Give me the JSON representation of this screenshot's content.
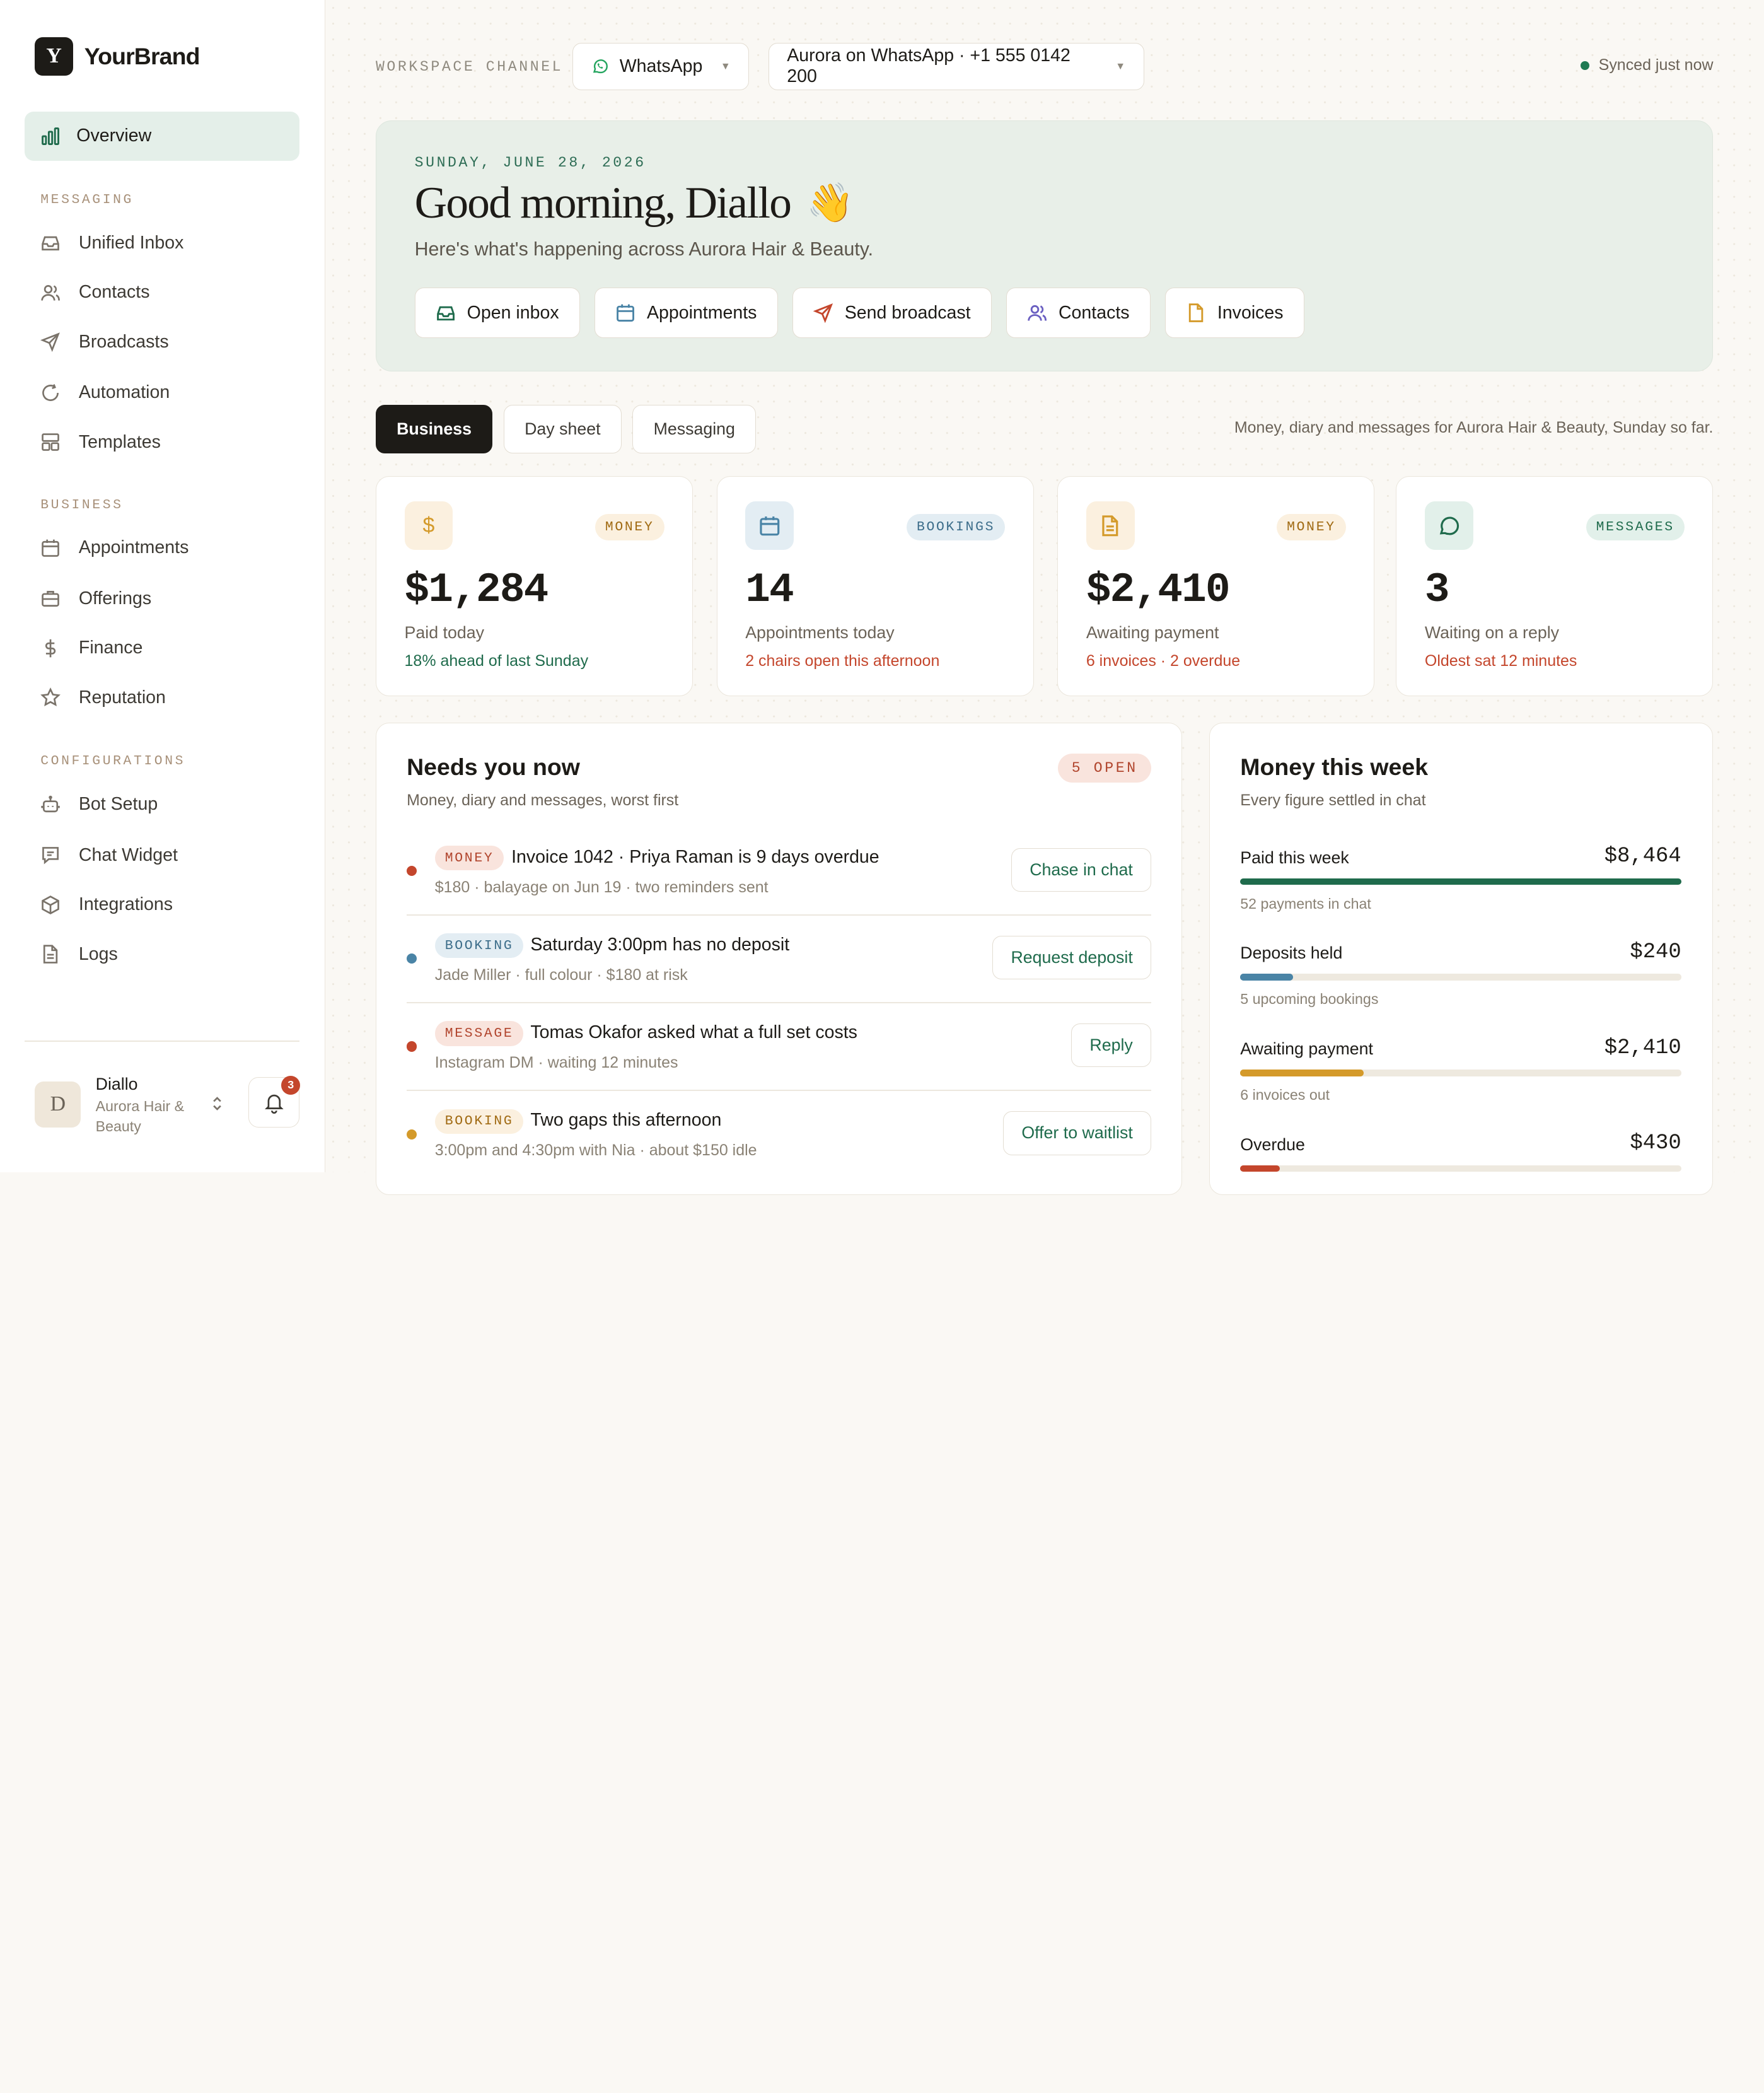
{
  "brand": {
    "logo_letter": "Y",
    "name": "YourBrand"
  },
  "nav": {
    "overview": "Overview",
    "sections": [
      {
        "title": "MESSAGING",
        "items": [
          "Unified Inbox",
          "Contacts",
          "Broadcasts",
          "Automation",
          "Templates"
        ]
      },
      {
        "title": "BUSINESS",
        "items": [
          "Appointments",
          "Offerings",
          "Finance",
          "Reputation"
        ]
      },
      {
        "title": "CONFIGURATIONS",
        "items": [
          "Bot Setup",
          "Chat Widget",
          "Integrations",
          "Logs"
        ]
      }
    ]
  },
  "user": {
    "initial": "D",
    "name": "Diallo",
    "business": "Aurora Hair & Beauty",
    "notifications": "3"
  },
  "topbar": {
    "workspace_label": "WORKSPACE CHANNEL",
    "channel": "WhatsApp",
    "account": "Aurora on WhatsApp · +1 555 0142 200",
    "sync_status": "Synced just now",
    "sync_color": "#1f7a52"
  },
  "hero": {
    "date": "SUNDAY, JUNE 28, 2026",
    "greeting": "Good morning, Diallo",
    "wave": "👋",
    "subtitle": "Here's what's happening across Aurora Hair & Beauty.",
    "quick_actions": [
      {
        "label": "Open inbox",
        "icon": "inbox-icon"
      },
      {
        "label": "Appointments",
        "icon": "calendar-icon"
      },
      {
        "label": "Send broadcast",
        "icon": "send-icon"
      },
      {
        "label": "Contacts",
        "icon": "users-icon"
      },
      {
        "label": "Invoices",
        "icon": "document-icon"
      }
    ]
  },
  "tabs": {
    "items": [
      "Business",
      "Day sheet",
      "Messaging"
    ],
    "active": "Business",
    "note": "Money, diary and messages for Aurora Hair & Beauty, Sunday so far."
  },
  "stats": [
    {
      "icon": "dollar-icon",
      "symbol": "$",
      "tag": "MONEY",
      "value": "$1,284",
      "label": "Paid today",
      "note": "18% ahead of last Sunday",
      "note_color": "#1f6b4c"
    },
    {
      "icon": "calendar-icon",
      "tag": "BOOKINGS",
      "value": "14",
      "label": "Appointments today",
      "note": "2 chairs open this afternoon",
      "note_color": "#c4462c"
    },
    {
      "icon": "document-icon",
      "tag": "MONEY",
      "value": "$2,410",
      "label": "Awaiting payment",
      "note": "6 invoices · 2 overdue",
      "note_color": "#c4462c"
    },
    {
      "icon": "chat-icon",
      "tag": "MESSAGES",
      "value": "3",
      "label": "Waiting on a reply",
      "note": "Oldest sat 12 minutes",
      "note_color": "#c4462c"
    }
  ],
  "needs": {
    "title": "Needs you now",
    "subtitle": "Money, diary and messages, worst first",
    "open_count": "5 OPEN",
    "items": [
      {
        "tag": "MONEY",
        "dot": "#c4462c",
        "title": "Invoice 1042 · Priya Raman is 9 days overdue",
        "meta": "$180 · balayage on Jun 19 · two reminders sent",
        "action": "Chase in chat"
      },
      {
        "tag": "BOOKING",
        "dot": "#4a84a6",
        "title": "Saturday 3:00pm has no deposit",
        "meta": "Jade Miller · full colour · $180 at risk",
        "action": "Request deposit"
      },
      {
        "tag": "MESSAGE",
        "dot": "#c4462c",
        "title": "Tomas Okafor asked what a full set costs",
        "meta": "Instagram DM · waiting 12 minutes",
        "action": "Reply"
      },
      {
        "tag": "BOOKING",
        "dot": "#d49a2a",
        "title": "Two gaps this afternoon",
        "meta": "3:00pm and 4:30pm with Nia · about $150 idle",
        "action": "Offer to waitlist"
      }
    ]
  },
  "money": {
    "title": "Money this week",
    "subtitle": "Every figure settled in chat",
    "rows": [
      {
        "label": "Paid this week",
        "amount": "$8,464",
        "fill": 1.0,
        "color": "#1f6b4c",
        "note": "52 payments in chat"
      },
      {
        "label": "Deposits held",
        "amount": "$240",
        "fill": 0.12,
        "color": "#4a84a6",
        "note": "5 upcoming bookings"
      },
      {
        "label": "Awaiting payment",
        "amount": "$2,410",
        "fill": 0.28,
        "color": "#d49a2a",
        "note": "6 invoices out"
      },
      {
        "label": "Overdue",
        "amount": "$430",
        "fill": 0.09,
        "color": "#c4462c",
        "note": ""
      }
    ]
  }
}
